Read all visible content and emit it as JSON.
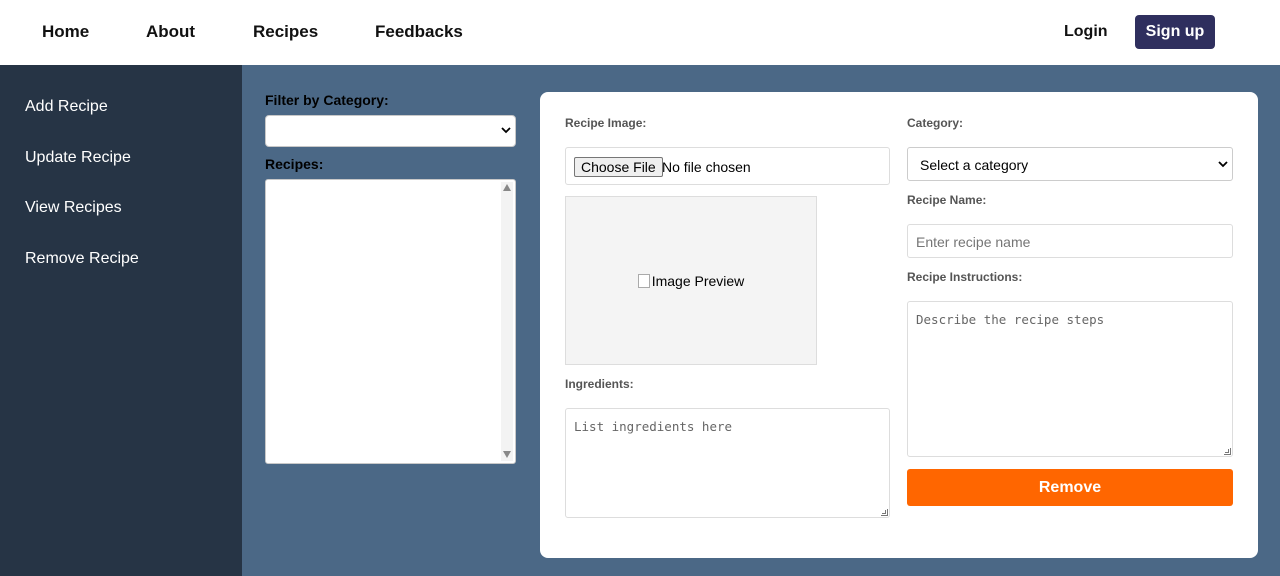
{
  "nav": {
    "home": "Home",
    "about": "About",
    "recipes": "Recipes",
    "feedbacks": "Feedbacks",
    "login": "Login",
    "signup": "Sign up"
  },
  "sidebar": {
    "items": [
      {
        "label": "Add Recipe"
      },
      {
        "label": "Update Recipe"
      },
      {
        "label": "View Recipes"
      },
      {
        "label": "Remove Recipe"
      }
    ]
  },
  "filter": {
    "label": "Filter by Category:",
    "selected": "",
    "recipes_label": "Recipes:"
  },
  "form": {
    "image_label": "Recipe Image:",
    "choose_file": "Choose File",
    "no_file": "No file chosen",
    "preview_alt": "Image Preview",
    "category_label": "Category:",
    "category_selected": "Select a category",
    "name_label": "Recipe Name:",
    "name_placeholder": "Enter recipe name",
    "instructions_label": "Recipe Instructions:",
    "instructions_placeholder": "Describe the recipe steps",
    "ingredients_label": "Ingredients:",
    "ingredients_placeholder": "List ingredients here",
    "remove_button": "Remove"
  },
  "colors": {
    "header_bg": "#ffffff",
    "sidebar_bg": "#263445",
    "main_bg": "#4b6886",
    "signup_bg": "#2f2f5e",
    "remove_bg": "#ff6600"
  }
}
